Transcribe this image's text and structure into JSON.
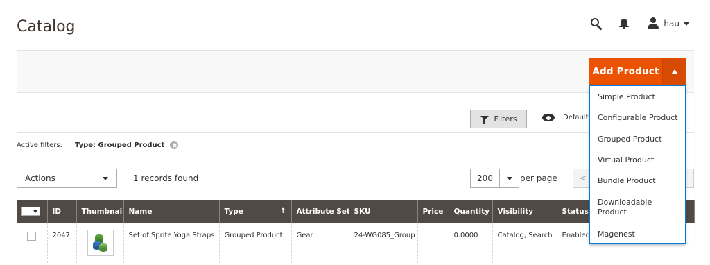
{
  "header": {
    "title": "Catalog",
    "user": "hau"
  },
  "add_product": {
    "label": "Add Product",
    "menu": [
      "Simple Product",
      "Configurable Product",
      "Grouped Product",
      "Virtual Product",
      "Bundle Product",
      "Downloadable Product",
      "Magenest"
    ]
  },
  "toolbar": {
    "filters_label": "Filters",
    "view_label": "Default View"
  },
  "active_filters": {
    "label": "Active filters:",
    "value": "Type: Grouped Product"
  },
  "grid_controls": {
    "actions_label": "Actions",
    "records_found": "1 records found",
    "per_page_value": "200",
    "per_page_label": "per page",
    "prev_label": "<"
  },
  "grid": {
    "columns": [
      "ID",
      "Thumbnail",
      "Name",
      "Type",
      "Attribute Set",
      "SKU",
      "Price",
      "Quantity",
      "Visibility",
      "Status"
    ],
    "sort_indicator": "↑",
    "rows": [
      {
        "id": "2047",
        "name": "Set of Sprite Yoga Straps",
        "type": "Grouped Product",
        "attribute_set": "Gear",
        "sku": "24-WG085_Group",
        "price": "",
        "quantity": "0.0000",
        "visibility": "Catalog, Search",
        "status": "Enabled"
      }
    ]
  },
  "colors": {
    "accent": "#eb5202",
    "grid_header": "#514943",
    "dropdown_border": "#007bdb"
  }
}
